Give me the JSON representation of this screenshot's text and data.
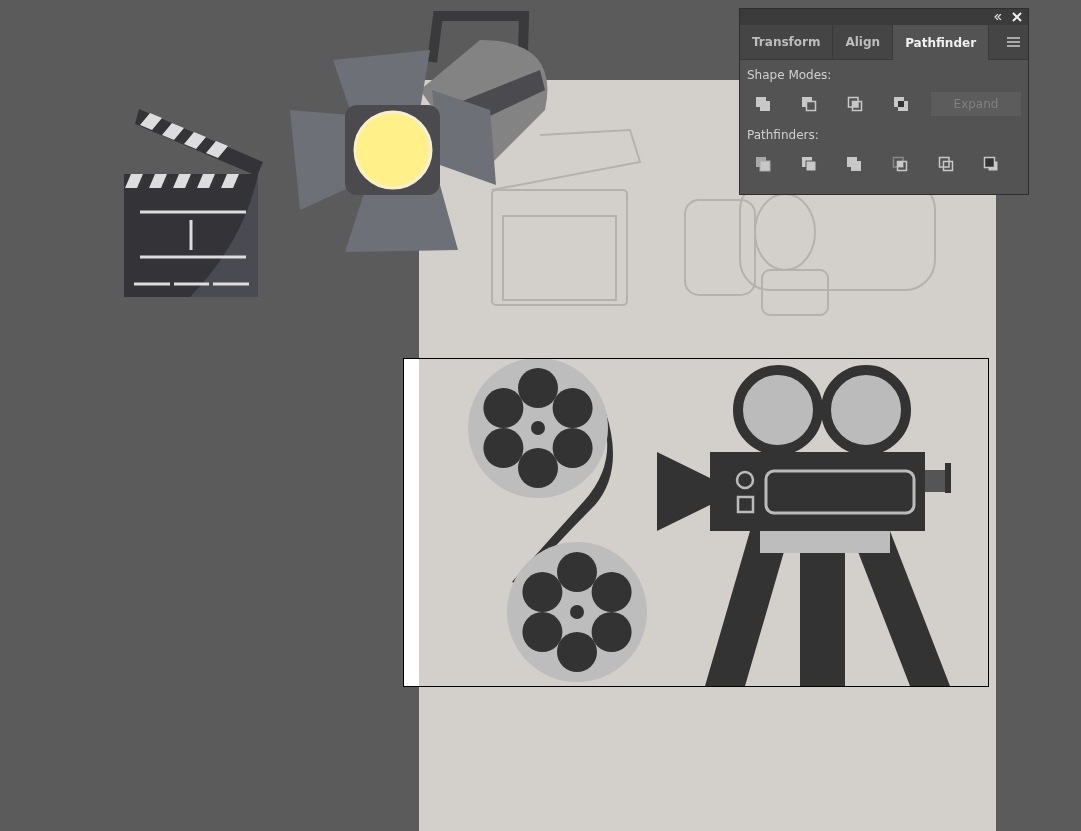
{
  "panel": {
    "tabs": [
      {
        "label": "Transform",
        "selected": false
      },
      {
        "label": "Align",
        "selected": false
      },
      {
        "label": "Pathfinder",
        "selected": true
      }
    ],
    "sections": [
      {
        "label": "Shape Modes:",
        "buttons": [
          {
            "kind": "unite"
          },
          {
            "kind": "minusfront"
          },
          {
            "kind": "intersect"
          },
          {
            "kind": "exclude"
          }
        ],
        "expand": {
          "label": "Expand",
          "disabled": true
        }
      },
      {
        "label": "Pathfinders:",
        "buttons": [
          {
            "kind": "divide"
          },
          {
            "kind": "trim"
          },
          {
            "kind": "merge"
          },
          {
            "kind": "crop"
          },
          {
            "kind": "outline"
          },
          {
            "kind": "minusback"
          }
        ]
      }
    ]
  }
}
